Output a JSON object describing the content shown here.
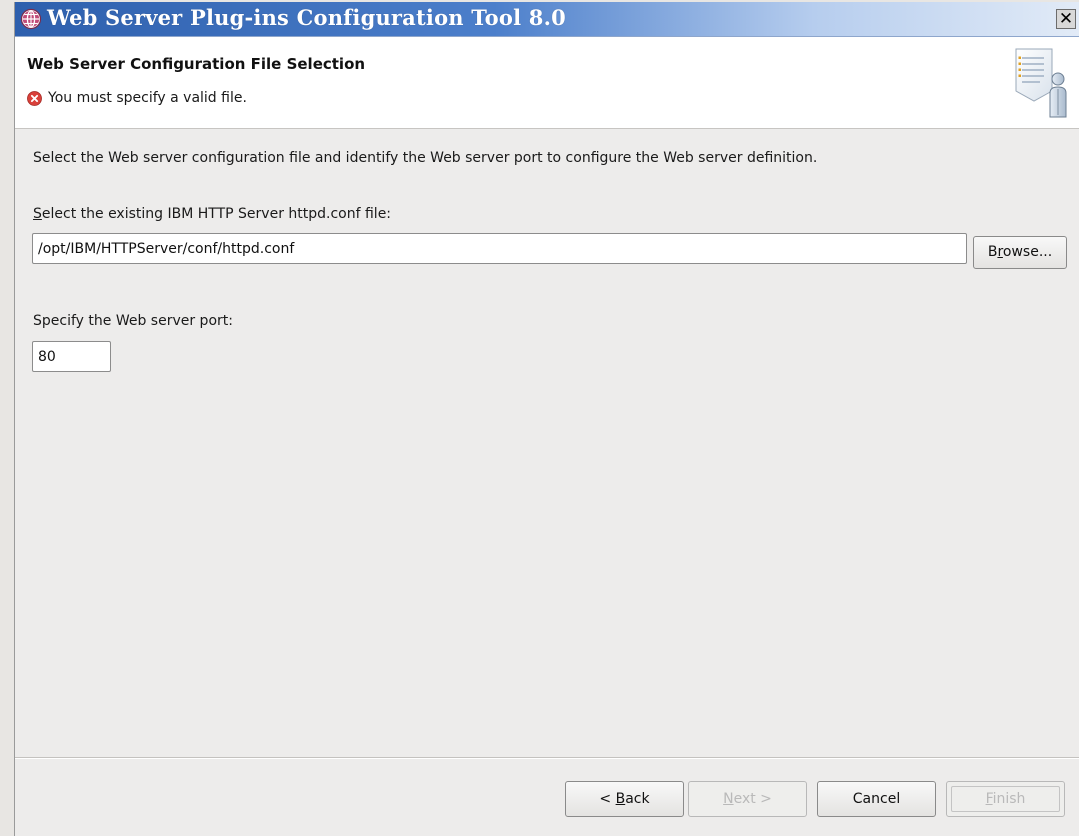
{
  "window": {
    "title": "Web Server Plug-ins Configuration Tool 8.0",
    "close_glyph": "✕",
    "title_icon": "globe-icon"
  },
  "header": {
    "title": "Web Server Configuration File Selection",
    "error_message": "You must specify a valid file.",
    "error_icon": "error-icon",
    "banner_icon": "wizard-checklist-person-icon"
  },
  "body": {
    "description": "Select the Web server configuration file and identify the Web server port to configure the Web server definition.",
    "config_file": {
      "label_mnemonic": "S",
      "label_rest": "elect the existing IBM HTTP Server httpd.conf file:",
      "value": "/opt/IBM/HTTPServer/conf/httpd.conf"
    },
    "browse_button": {
      "pre": "B",
      "mnemonic": "r",
      "post": "owse..."
    },
    "port": {
      "label": "Specify the Web server port:",
      "value": "80"
    }
  },
  "footer": {
    "back": {
      "pre": "< ",
      "mnemonic": "B",
      "post": "ack"
    },
    "next": {
      "mnemonic": "N",
      "post": "ext >",
      "enabled": false
    },
    "cancel": {
      "label": "Cancel"
    },
    "finish": {
      "mnemonic": "F",
      "post": "inish",
      "enabled": false
    }
  },
  "colors": {
    "titlebar_start": "#2d5fad",
    "titlebar_end": "#e2ebf7",
    "error_red": "#d9403a",
    "dialog_bg": "#edeceb"
  }
}
